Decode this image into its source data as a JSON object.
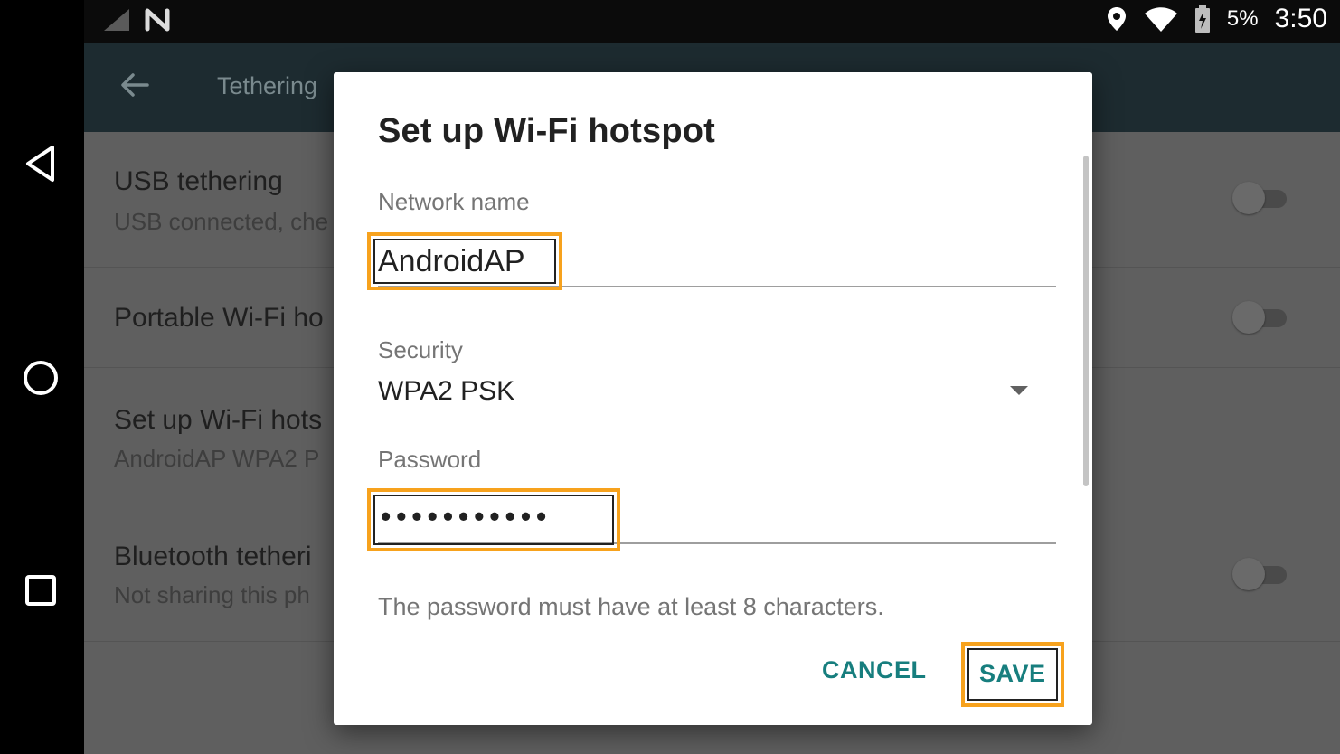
{
  "status_bar": {
    "battery_percent": "5%",
    "time": "3:50",
    "icons": [
      "signal-icon",
      "no-sim-icon",
      "location-icon",
      "wifi-icon",
      "battery-charging-icon"
    ]
  },
  "app_bar": {
    "title": "Tethering"
  },
  "settings_list": {
    "items": [
      {
        "title": "USB tethering",
        "subtitle": "USB connected, che"
      },
      {
        "title": "Portable Wi-Fi ho",
        "subtitle": ""
      },
      {
        "title": "Set up Wi-Fi hots",
        "subtitle": "AndroidAP WPA2 P"
      },
      {
        "title": "Bluetooth tetheri",
        "subtitle": "Not sharing this ph"
      }
    ]
  },
  "dialog": {
    "title": "Set up Wi-Fi hotspot",
    "network_name": {
      "label": "Network name",
      "value": "AndroidAP"
    },
    "security": {
      "label": "Security",
      "value": "WPA2 PSK"
    },
    "password": {
      "label": "Password",
      "value": "•••••••••••"
    },
    "helper_text": "The password must have at least 8 characters.",
    "buttons": {
      "cancel": "CANCEL",
      "save": "SAVE"
    }
  },
  "colors": {
    "accent": "#177e7e",
    "highlight": "#f7a21d",
    "app_bar": "#1d2b30",
    "scrim_list": "#5f5f5f"
  }
}
